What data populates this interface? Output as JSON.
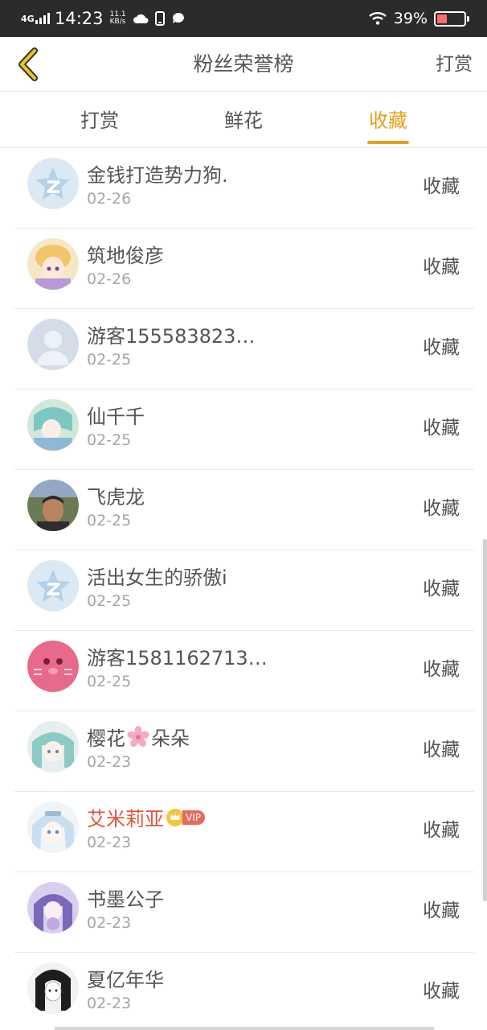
{
  "status_bar": {
    "network": "4G",
    "time": "14:23",
    "speed_value": "11.1",
    "speed_unit": "KB/s",
    "battery_percent": "39%",
    "battery_level": 0.39,
    "icons": [
      "cloud-icon",
      "phone-icon",
      "chat-bubble-icon",
      "wifi-icon",
      "battery-icon"
    ]
  },
  "header": {
    "title": "粉丝荣誉榜",
    "action": "打赏",
    "back_icon": "chevron-left-icon"
  },
  "tabs": [
    {
      "label": "打赏",
      "active": false
    },
    {
      "label": "鲜花",
      "active": false
    },
    {
      "label": "收藏",
      "active": true
    }
  ],
  "colors": {
    "accent": "#e8a21a",
    "vip_name": "#e0543b",
    "status_bar_bg": "#2b2b2b"
  },
  "list": [
    {
      "name": "金钱打造势力狗.",
      "date": "02-26",
      "action": "收藏",
      "avatar": "qzone-default-avatar"
    },
    {
      "name": "筑地俊彦",
      "date": "02-26",
      "action": "收藏",
      "avatar": "anime-girl-avatar"
    },
    {
      "name": "游客155583823…",
      "date": "02-25",
      "action": "收藏",
      "avatar": "default-person-avatar"
    },
    {
      "name": "仙千千",
      "date": "02-25",
      "action": "收藏",
      "avatar": "anime-avatar"
    },
    {
      "name": "飞虎龙",
      "date": "02-25",
      "action": "收藏",
      "avatar": "photo-man-avatar"
    },
    {
      "name": "活出女生的骄傲i",
      "date": "02-25",
      "action": "收藏",
      "avatar": "qzone-default-avatar"
    },
    {
      "name": "游客1581162713…",
      "date": "02-25",
      "action": "收藏",
      "avatar": "pink-face-avatar"
    },
    {
      "name": "樱花",
      "name_suffix": "朵朵",
      "emoji": "cherry-blossom-icon",
      "date": "02-23",
      "action": "收藏",
      "avatar": "anime-girl-avatar"
    },
    {
      "name": "艾米莉亚",
      "vip": "VIP",
      "date": "02-23",
      "action": "收藏",
      "avatar": "anime-white-hair-avatar"
    },
    {
      "name": "书墨公子",
      "date": "02-23",
      "action": "收藏",
      "avatar": "anime-purple-avatar"
    },
    {
      "name": "夏亿年华",
      "date": "02-23",
      "action": "收藏",
      "avatar": "sketch-girl-avatar"
    }
  ]
}
